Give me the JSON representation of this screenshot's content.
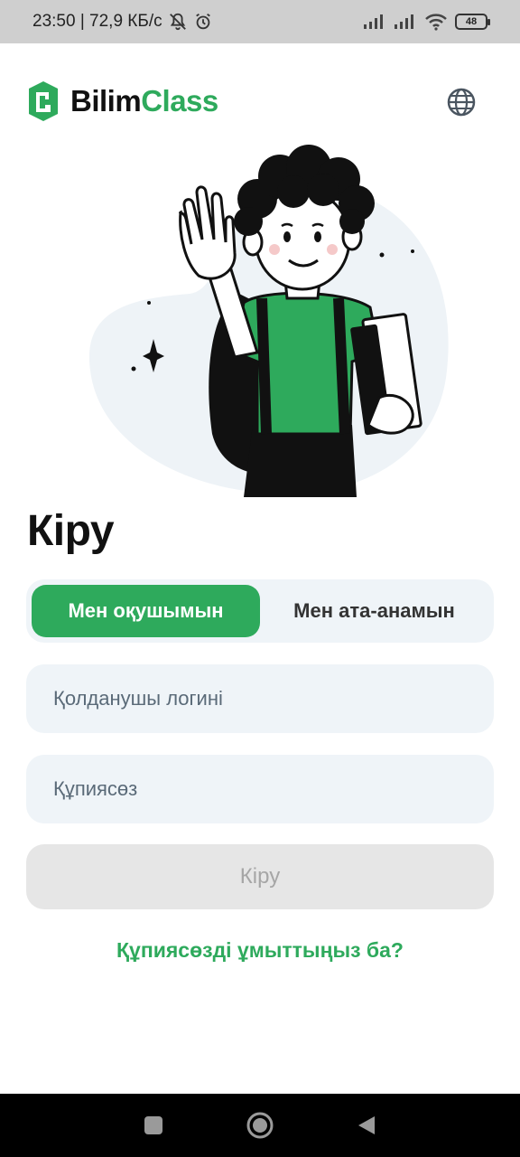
{
  "status_bar": {
    "time_speed": "23:50 | 72,9 КБ/с",
    "battery": "48"
  },
  "header": {
    "logo_word1": "Bilim",
    "logo_word2": "Class",
    "globe_icon": "globe-icon"
  },
  "title": "Кіру",
  "segments": {
    "student": "Мен оқушымын",
    "parent": "Мен ата-анамын",
    "selected": "student"
  },
  "form": {
    "login_placeholder": "Қолданушы логині",
    "password_placeholder": "Құпиясөз",
    "login_button": "Кіру"
  },
  "forgot_link": "Құпиясөзді ұмыттыңыз ба?",
  "colors": {
    "accent": "#2eaa5c",
    "field_bg": "#eff4f8",
    "disabled_btn": "#e6e6e6"
  },
  "nav_icons": [
    "recent-apps-icon",
    "home-icon",
    "back-icon"
  ]
}
